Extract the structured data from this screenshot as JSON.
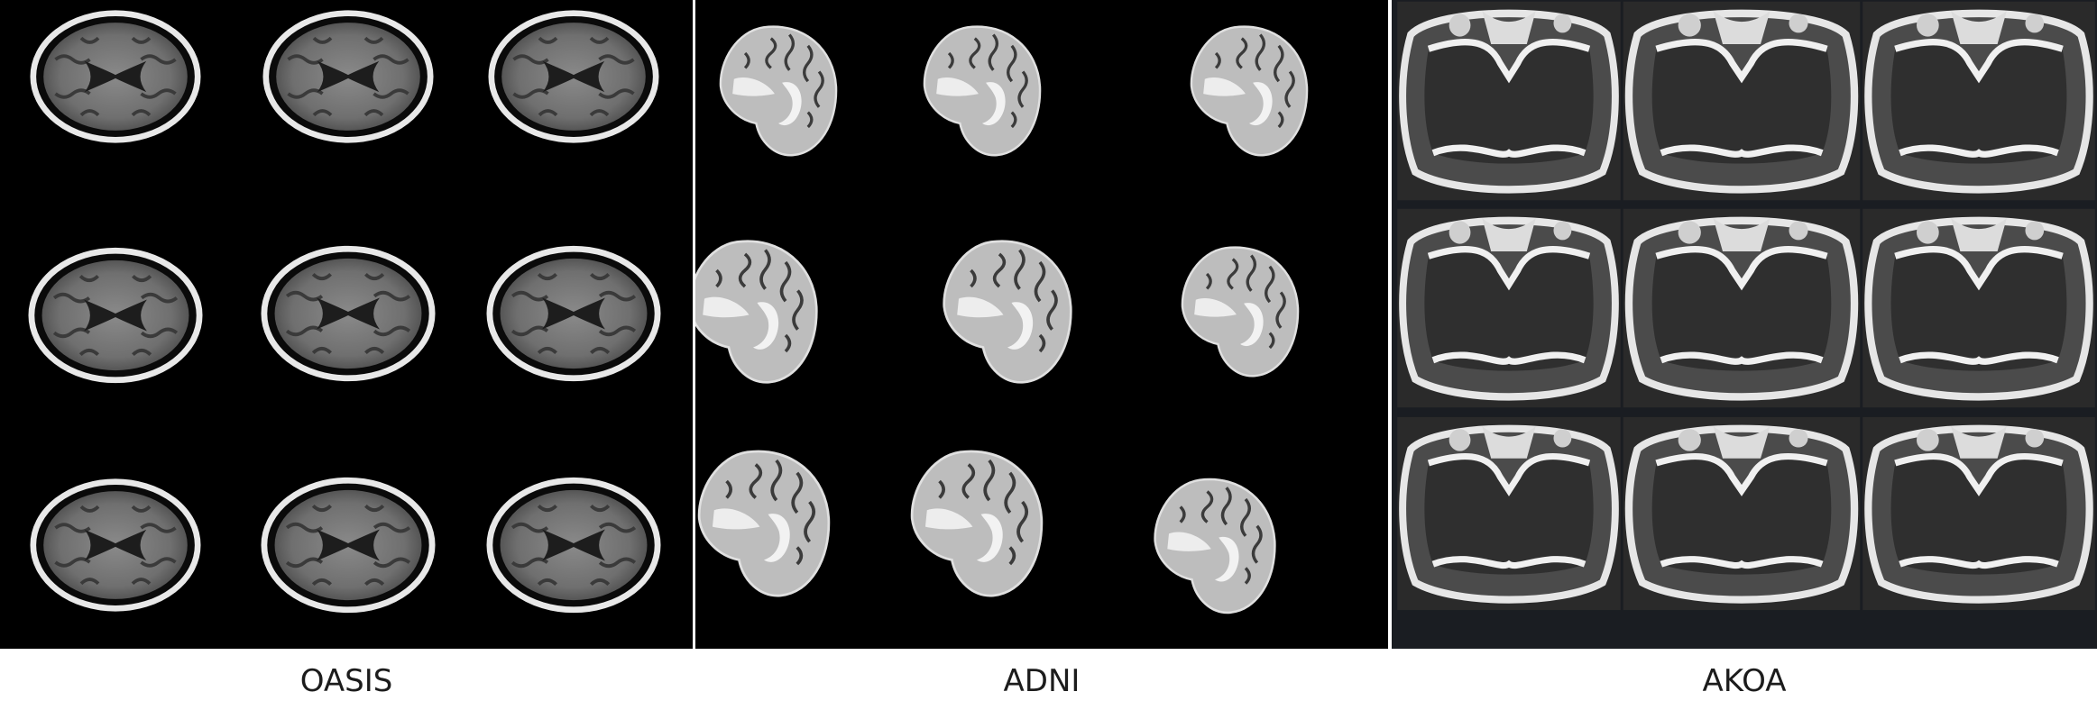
{
  "panels": [
    {
      "id": "oasis",
      "caption": "OASIS",
      "kind": "axial brain MRI",
      "rows": 3,
      "cols": 3
    },
    {
      "id": "adni",
      "caption": "ADNI",
      "kind": "sagittal brain MRI",
      "rows": 3,
      "cols": 3
    },
    {
      "id": "akoa",
      "caption": "AKOA",
      "kind": "knee MRI",
      "rows": 3,
      "cols": 3
    }
  ],
  "colors": {
    "background": "#000000",
    "akoa_background": "#1a1d22",
    "page": "#ffffff"
  }
}
